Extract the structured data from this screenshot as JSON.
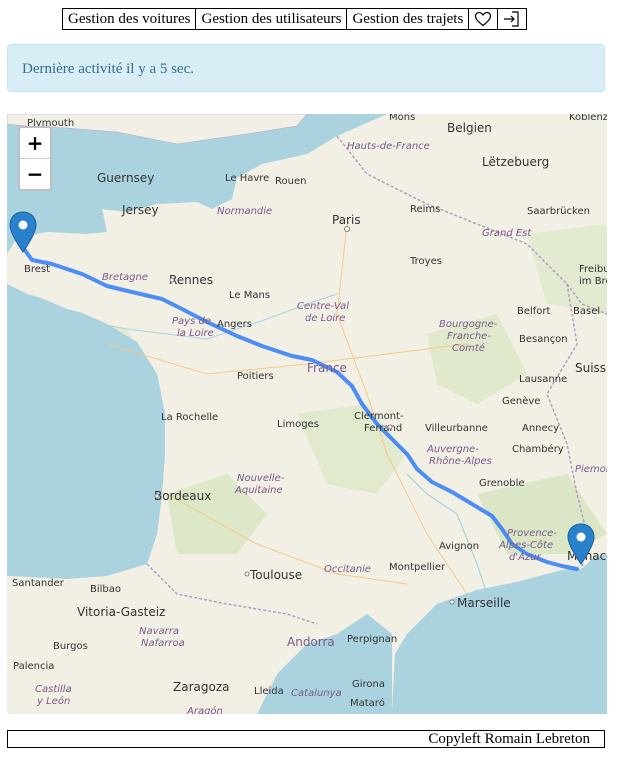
{
  "nav": {
    "items": [
      {
        "label": "Gestion des voitures"
      },
      {
        "label": "Gestion des utilisateurs"
      },
      {
        "label": "Gestion des trajets"
      }
    ],
    "favorite_icon": "heart-icon",
    "logout_icon": "logout-icon"
  },
  "alert": {
    "text": "Dernière activité il y a 5 sec."
  },
  "map": {
    "zoom_in": "+",
    "zoom_out": "−",
    "route_color": "#3b82f6",
    "route": {
      "start": "Brest",
      "end": "Monaco"
    },
    "labels": {
      "plymouth": "Plymouth",
      "guernsey": "Guernsey",
      "jersey": "Jersey",
      "le_havre": "Le Havre",
      "rouen": "Rouen",
      "normandie": "Normandie",
      "mons": "Mons",
      "belgien": "Belgien",
      "koblenz": "Koblenz",
      "letzebuerg": "Lëtzebuerg",
      "hauts_de_france": "Hauts-de-France",
      "paris": "Paris",
      "reims": "Reims",
      "grand_est": "Grand Est",
      "saarbrucken": "Saarbrücken",
      "brest": "Brest",
      "bretagne": "Bretagne",
      "rennes": "Rennes",
      "le_mans": "Le Mans",
      "troyes": "Troyes",
      "freibu": "Freibu",
      "im_breis": "im Breis",
      "centre_val": "Centre-Val",
      "de_loire": "de Loire",
      "pays_de_la_loire_1": "Pays de",
      "pays_de_la_loire_2": "la Loire",
      "angers": "Angers",
      "bourgogne": "Bourgogne-",
      "franche": "Franche-",
      "comte": "Comté",
      "belfort": "Belfort",
      "basel": "Basel",
      "besancon": "Besançon",
      "poitiers": "Poitiers",
      "france": "France",
      "lausanne": "Lausanne",
      "suiss": "Suiss",
      "la_rochelle": "La Rochelle",
      "limoges": "Limoges",
      "clermont": "Clermont-",
      "ferrand": "Ferrand",
      "villeurbanne": "Villeurbanne",
      "geneve": "Genève",
      "annecy": "Annecy",
      "auvergne": "Auvergne-",
      "rhone_alpes": "Rhône-Alpes",
      "chambery": "Chambéry",
      "nouvelle": "Nouvelle-",
      "aquitaine": "Aquitaine",
      "bordeaux": "Bordeaux",
      "piemon": "Piemon",
      "grenoble": "Grenoble",
      "provence": "Provence-",
      "alpes_cote": "Alpes-Côte",
      "d_azur": "d'Azur",
      "avignon": "Avignon",
      "monaco": "Monaco",
      "toulouse": "Toulouse",
      "occitanie": "Occitanie",
      "montpellier": "Montpellier",
      "marseille": "Marseille",
      "santander": "Santander",
      "bilbao": "Bilbao",
      "vitoria": "Vitoria-Gasteiz",
      "navarra": "Navarra",
      "nafarroa": "Nafarroa",
      "burgos": "Burgos",
      "andorra": "Andorra",
      "perpignan": "Perpignan",
      "palencia": "Palencia",
      "castilla": "Castilla",
      "y_leon": "y León",
      "zaragoza": "Zaragoza",
      "lleida": "Lleida",
      "catalunya": "Catalunya",
      "girona": "Girona",
      "mataro": "Mataró",
      "aragon": "Aragón"
    }
  },
  "footer": {
    "text": "Copyleft Romain Lebreton"
  }
}
